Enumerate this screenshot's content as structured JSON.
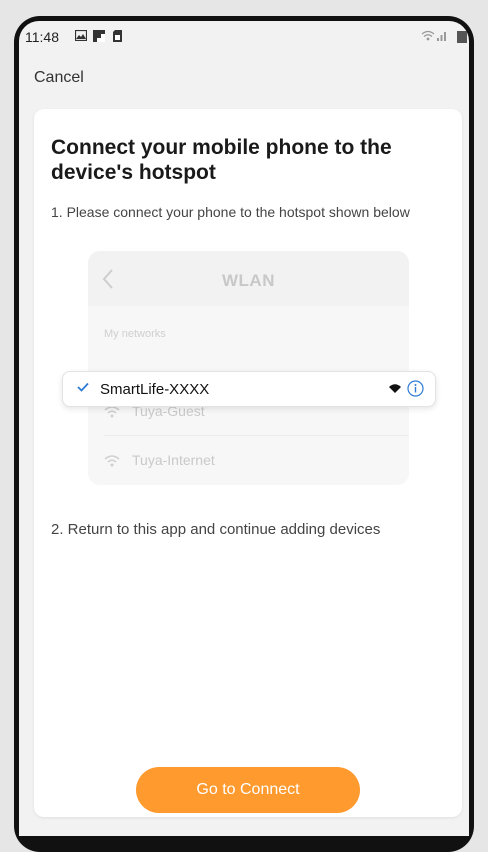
{
  "status_bar": {
    "time": "11:48",
    "icons": [
      "image-icon",
      "flipboard-icon",
      "sim-icon",
      "wifi-icon",
      "signal-icon",
      "battery-icon"
    ]
  },
  "header": {
    "cancel_label": "Cancel"
  },
  "card": {
    "title": "Connect your mobile phone to the device's hotspot",
    "step1": "1. Please connect your phone to the hotspot shown below",
    "illustration": {
      "title": "WLAN",
      "section_label": "My networks",
      "selected_network": "SmartLife-XXXX",
      "other_networks": [
        "Tuya-Guest",
        "Tuya-Internet"
      ]
    },
    "step2": "2. Return to this app and continue adding devices",
    "connect_button": "Go to Connect"
  },
  "colors": {
    "accent": "#ff9a2e",
    "check": "#2e7bd6"
  }
}
